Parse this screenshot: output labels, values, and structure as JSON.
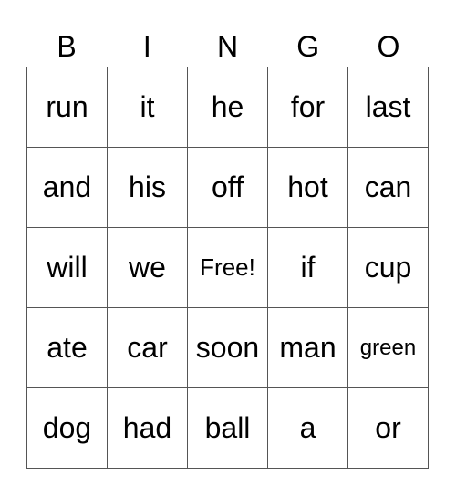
{
  "header": [
    "B",
    "I",
    "N",
    "G",
    "O"
  ],
  "rows": [
    [
      "run",
      "it",
      "he",
      "for",
      "last"
    ],
    [
      "and",
      "his",
      "off",
      "hot",
      "can"
    ],
    [
      "will",
      "we",
      "Free!",
      "if",
      "cup"
    ],
    [
      "ate",
      "car",
      "soon",
      "man",
      "green"
    ],
    [
      "dog",
      "had",
      "ball",
      "a",
      "or"
    ]
  ]
}
